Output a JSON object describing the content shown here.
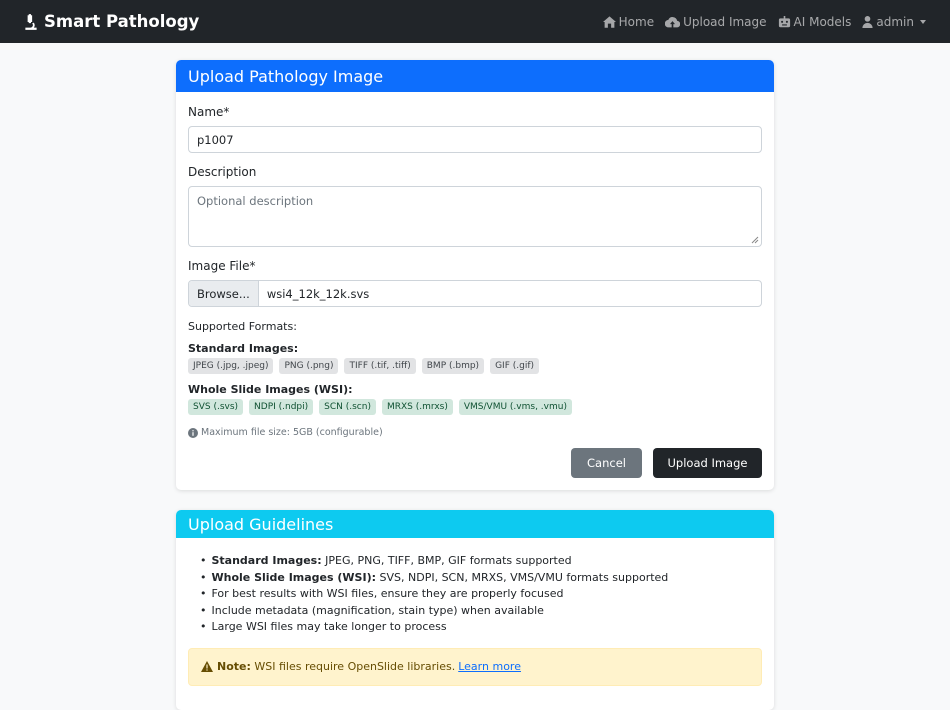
{
  "navbar": {
    "brand": "Smart Pathology",
    "links": [
      {
        "label": "Home",
        "icon": "home-icon"
      },
      {
        "label": "Upload Image",
        "icon": "cloud-upload-icon"
      },
      {
        "label": "AI Models",
        "icon": "robot-icon"
      },
      {
        "label": "admin",
        "icon": "user-icon"
      }
    ]
  },
  "upload_form": {
    "title": "Upload Pathology Image",
    "name_label": "Name*",
    "name_value": "p1007",
    "description_label": "Description",
    "description_placeholder": "Optional description",
    "file_label": "Image File*",
    "browse_label": "Browse...",
    "file_name": "wsi4_12k_12k.svs",
    "supported_label": "Supported Formats:",
    "standard_title": "Standard Images:",
    "standard_formats": [
      "JPEG (.jpg, .jpeg)",
      "PNG (.png)",
      "TIFF (.tif, .tiff)",
      "BMP (.bmp)",
      "GIF (.gif)"
    ],
    "wsi_title": "Whole Slide Images (WSI):",
    "wsi_formats": [
      "SVS (.svs)",
      "NDPI (.ndpi)",
      "SCN (.scn)",
      "MRXS (.mrxs)",
      "VMS/VMU (.vms, .vmu)"
    ],
    "max_size_note": "Maximum file size: 5GB (configurable)",
    "cancel_label": "Cancel",
    "upload_label": "Upload Image"
  },
  "guidelines": {
    "title": "Upload Guidelines",
    "items": [
      {
        "bold": "Standard Images:",
        "text": " JPEG, PNG, TIFF, BMP, GIF formats supported"
      },
      {
        "bold": "Whole Slide Images (WSI):",
        "text": " SVS, NDPI, SCN, MRXS, VMS/VMU formats supported"
      },
      {
        "bold": "",
        "text": "For best results with WSI files, ensure they are properly focused"
      },
      {
        "bold": "",
        "text": "Include metadata (magnification, stain type) when available"
      },
      {
        "bold": "",
        "text": "Large WSI files may take longer to process"
      }
    ],
    "note_label": "Note:",
    "note_text": "WSI files require OpenSlide libraries.",
    "note_link": "Learn more"
  },
  "colors": {
    "navbar": "#212529",
    "primary": "#0d6efd",
    "info": "#0dcaf0",
    "warning_bg": "#fff3cd"
  }
}
